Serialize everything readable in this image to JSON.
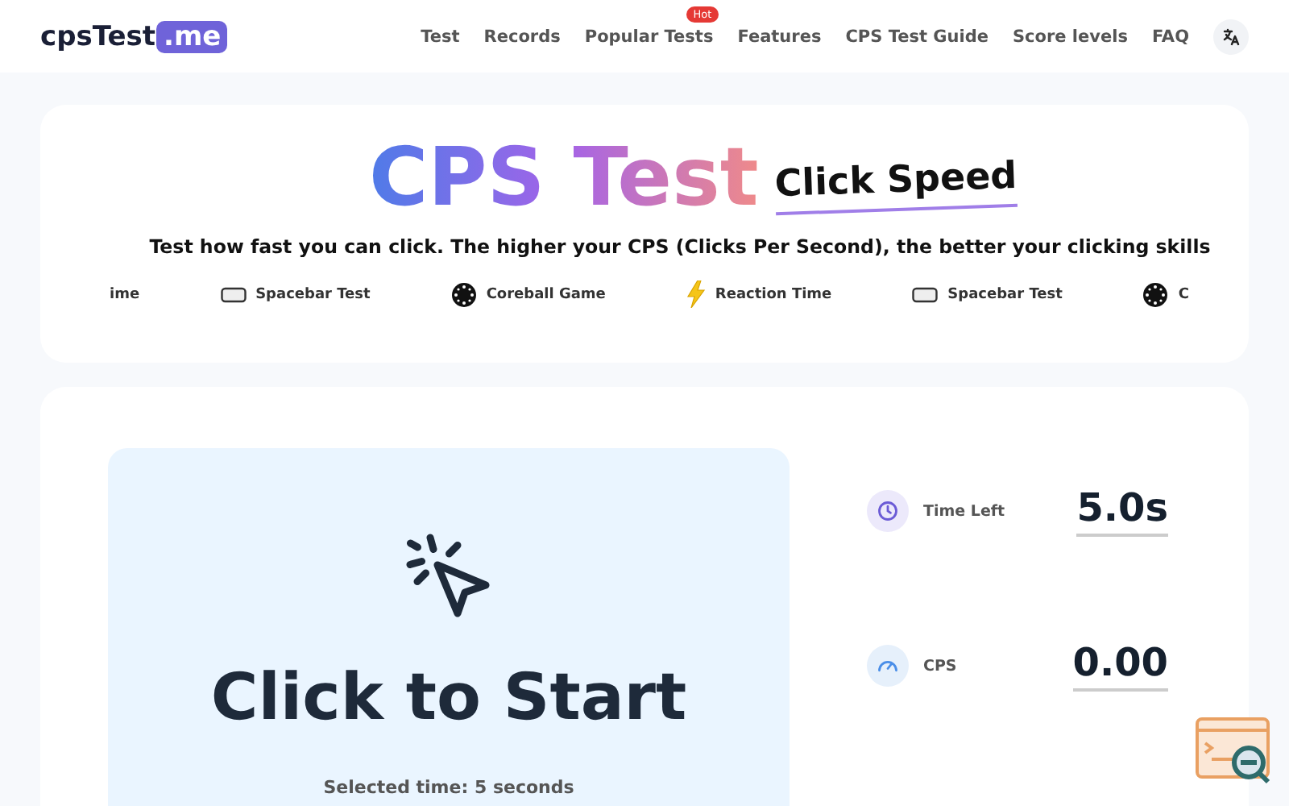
{
  "header": {
    "logo": {
      "text": "cpsTest",
      "suffix": ".me"
    },
    "nav": [
      {
        "label": "Test"
      },
      {
        "label": "Records"
      },
      {
        "label": "Popular Tests",
        "badge": "Hot"
      },
      {
        "label": "Features"
      },
      {
        "label": "CPS Test Guide"
      },
      {
        "label": "Score levels"
      },
      {
        "label": "FAQ"
      }
    ]
  },
  "hero": {
    "title": "CPS Test",
    "tag": "Click Speed",
    "description": "Test how fast you can click. The higher your CPS (Clicks Per Second), the better your clicking skills"
  },
  "marquee": [
    {
      "label": "ime"
    },
    {
      "kind": "keyboard",
      "label": "Spacebar Test"
    },
    {
      "kind": "ball",
      "label": "Coreball Game"
    },
    {
      "kind": "lightning",
      "label": "Reaction Time"
    },
    {
      "kind": "keyboard",
      "label": "Spacebar Test"
    },
    {
      "kind": "ball",
      "label": "C"
    }
  ],
  "test_area": {
    "prompt": "Click to Start",
    "note": "Selected time: 5 seconds"
  },
  "stats": [
    {
      "kind": "time",
      "label": "Time Left",
      "value": "5.0s"
    },
    {
      "kind": "speed",
      "label": "CPS",
      "value": "0.00"
    }
  ]
}
